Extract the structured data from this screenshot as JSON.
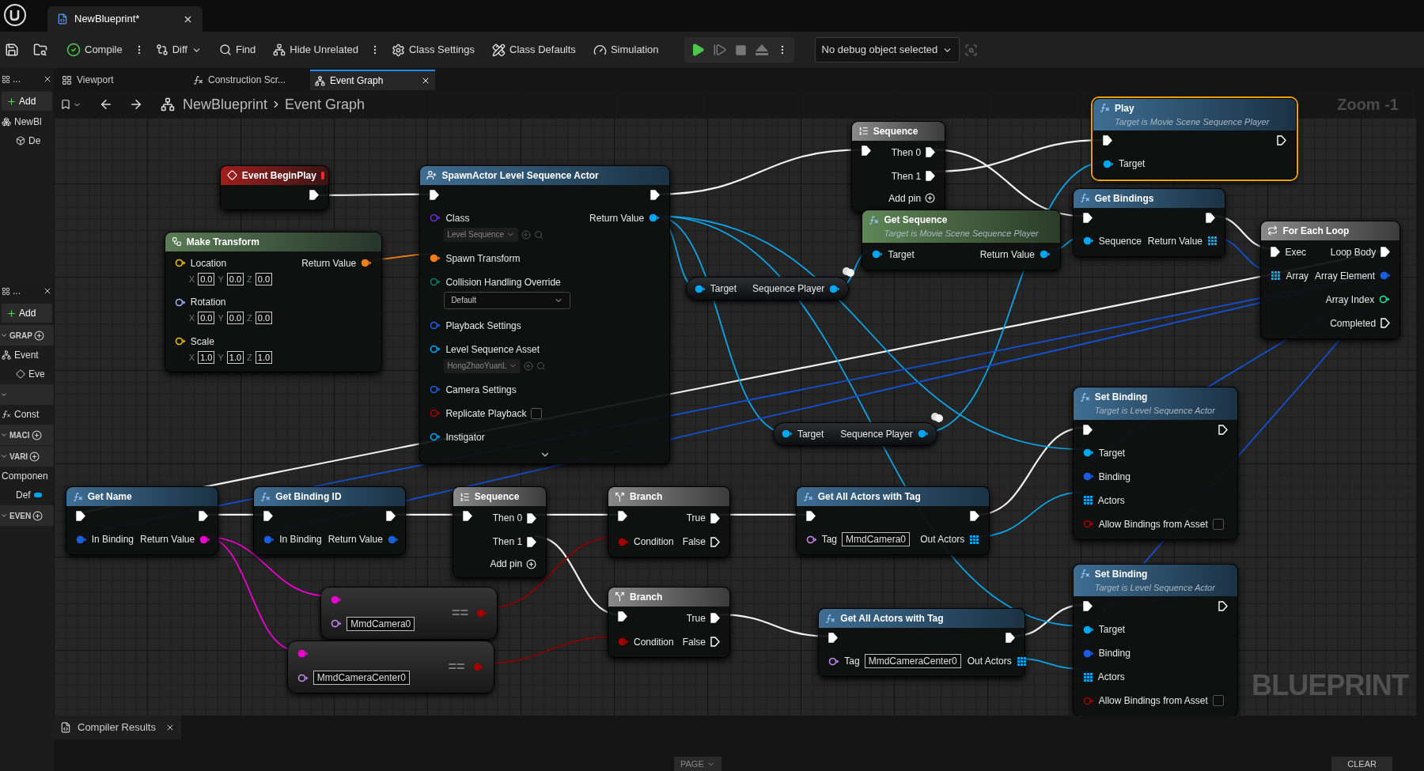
{
  "title_bar": {
    "tabs": [
      {
        "label": "NewBlueprint*",
        "selected": true
      }
    ]
  },
  "toolbar": {
    "buttons": [
      {
        "kind": "compile",
        "label": "Compile"
      },
      {
        "kind": "diff",
        "label": "Diff"
      },
      {
        "kind": "find",
        "label": "Find"
      },
      {
        "kind": "hide-unrelated",
        "label": "Hide Unrelated"
      },
      {
        "kind": "class-settings",
        "label": "Class Settings"
      },
      {
        "kind": "class-defaults",
        "label": "Class Defaults"
      },
      {
        "kind": "simulation",
        "label": "Simulation"
      }
    ],
    "debug_object": "No debug object selected"
  },
  "components_panel": {
    "tab": "...",
    "add": "Add",
    "tree": [
      {
        "label": "NewBl",
        "children": [
          {
            "label": "De"
          }
        ]
      }
    ]
  },
  "my_blueprint_panel": {
    "tab": "...",
    "add": "Add",
    "sections": [
      {
        "label": "GRAP",
        "items": [
          {
            "kind": "graph",
            "label": "Event",
            "children": [
              {
                "kind": "event",
                "label": "Eve"
              }
            ]
          }
        ]
      },
      {
        "items": [
          {
            "kind": "function",
            "label": "Const"
          }
        ]
      },
      {
        "label": "MACI"
      },
      {
        "label": "VARI",
        "items": [
          {
            "kind": "category",
            "label": "Componen",
            "children": [
              {
                "kind": "variable",
                "label": "Def"
              }
            ]
          }
        ]
      },
      {
        "label": "EVEN"
      }
    ]
  },
  "editor_tabs": [
    {
      "kind": "viewport",
      "label": "Viewport",
      "selected": false
    },
    {
      "kind": "function",
      "label": "Construction Scr...",
      "selected": false
    },
    {
      "kind": "graph",
      "label": "Event Graph",
      "selected": true
    }
  ],
  "graph": {
    "breadcrumb": [
      "NewBlueprint",
      "Event Graph"
    ],
    "zoom": "Zoom -1",
    "watermark": "BLUEPRINT",
    "nodes": [
      {
        "kind": "sequence",
        "title": "Sequence",
        "selected": false,
        "rows": [
          {
            "in": {
              "kind": "exec",
              "linked": true
            },
            "out": {
              "kind": "exec",
              "label": "Then 0",
              "linked": true
            }
          },
          {
            "out": {
              "kind": "exec",
              "label": "Then 1",
              "linked": true
            }
          }
        ],
        "add_pin": "Add pin"
      },
      {
        "kind": "function",
        "title": "Play",
        "subtitle": "Target is Movie Scene Sequence Player",
        "selected": true,
        "rows": [
          {
            "in": {
              "kind": "exec",
              "linked": true
            },
            "out": {
              "kind": "exec",
              "linked": false
            }
          },
          {
            "in": {
              "kind": "object",
              "label": "Target",
              "linked": true
            }
          }
        ]
      },
      {
        "kind": "event",
        "title": "Event BeginPlay",
        "selected": false,
        "rows": [
          {
            "out": {
              "kind": "exec",
              "linked": true
            }
          }
        ]
      },
      {
        "kind": "spawn",
        "title": "SpawnActor Level Sequence Actor",
        "selected": false,
        "advanced_expanded": false,
        "rows": [
          {
            "in": {
              "kind": "exec",
              "linked": true
            },
            "out": {
              "kind": "exec",
              "linked": true
            }
          },
          {
            "in": {
              "kind": "class",
              "label": "Class",
              "linked": false,
              "dropdown": "Level Sequence"
            },
            "out": {
              "kind": "object",
              "label": "Return Value",
              "linked": true
            }
          },
          {
            "in": {
              "kind": "transform",
              "label": "Spawn Transform",
              "linked": true
            }
          },
          {
            "in": {
              "kind": "enum",
              "label": "Collision Handling Override",
              "linked": false,
              "select": "Default"
            }
          },
          {
            "in": {
              "kind": "struct",
              "label": "Playback Settings",
              "linked": false
            }
          },
          {
            "in": {
              "kind": "object",
              "label": "Level Sequence Asset",
              "linked": false,
              "dropdown": "HongZhaoYuanL"
            }
          },
          {
            "in": {
              "kind": "struct",
              "label": "Camera Settings",
              "linked": false
            }
          },
          {
            "in": {
              "kind": "bool",
              "label": "Replicate Playback",
              "linked": false,
              "checked": false
            }
          },
          {
            "in": {
              "kind": "object",
              "label": "Instigator",
              "linked": false
            }
          }
        ]
      },
      {
        "kind": "function",
        "title": "Get Bindings",
        "selected": false,
        "rows": [
          {
            "in": {
              "kind": "exec",
              "linked": true
            },
            "out": {
              "kind": "exec",
              "linked": true
            }
          },
          {
            "in": {
              "kind": "object",
              "label": "Sequence",
              "linked": true
            },
            "out": {
              "kind": "array",
              "label": "Return Value",
              "linked": true
            }
          }
        ]
      },
      {
        "kind": "pure",
        "title": "Get Sequence",
        "subtitle": "Target is Movie Scene Sequence Player",
        "selected": false,
        "rows": [
          {
            "in": {
              "kind": "object",
              "label": "Target",
              "linked": true
            },
            "out": {
              "kind": "object",
              "label": "Return Value",
              "linked": true
            }
          }
        ]
      },
      {
        "kind": "loop",
        "title": "For Each Loop",
        "selected": false,
        "rows": [
          {
            "in": {
              "kind": "exec",
              "label": "Exec",
              "linked": true
            },
            "out": {
              "kind": "exec",
              "label": "Loop Body",
              "linked": true
            }
          },
          {
            "in": {
              "kind": "array",
              "label": "Array",
              "linked": true
            },
            "out": {
              "kind": "binding",
              "label": "Array Element",
              "linked": true
            }
          },
          {
            "out": {
              "kind": "int",
              "label": "Array Index",
              "linked": false
            }
          },
          {
            "out": {
              "kind": "exec",
              "label": "Completed",
              "linked": false
            }
          }
        ]
      },
      {
        "kind": "make-struct",
        "title": "Make Transform",
        "selected": false,
        "rows": [
          {
            "in": {
              "kind": "vector",
              "label": "Location",
              "linked": false,
              "fields": [
                {
                  "axis": "X",
                  "value": "0.0"
                },
                {
                  "axis": "Y",
                  "value": "0.0"
                },
                {
                  "axis": "Z",
                  "value": "0.0"
                }
              ]
            },
            "out": {
              "kind": "transform",
              "label": "Return Value",
              "linked": true
            }
          },
          {
            "in": {
              "kind": "rotator",
              "label": "Rotation",
              "linked": false,
              "fields": [
                {
                  "axis": "X",
                  "value": "0.0"
                },
                {
                  "axis": "Y",
                  "value": "0.0"
                },
                {
                  "axis": "Z",
                  "value": "0.0"
                }
              ]
            }
          },
          {
            "in": {
              "kind": "vector",
              "label": "Scale",
              "linked": false,
              "fields": [
                {
                  "axis": "X",
                  "value": "1.0"
                },
                {
                  "axis": "Y",
                  "value": "1.0"
                },
                {
                  "axis": "Z",
                  "value": "1.0"
                }
              ]
            }
          }
        ]
      },
      {
        "kind": "getter",
        "selected": false,
        "rows": [
          {
            "in": {
              "kind": "object",
              "label": "Target",
              "linked": true
            },
            "out": {
              "kind": "object",
              "label": "Sequence Player",
              "linked": true
            }
          }
        ]
      },
      {
        "kind": "function",
        "title": "Set Binding",
        "subtitle": "Target is Level Sequence Actor",
        "selected": false,
        "rows": [
          {
            "in": {
              "kind": "exec",
              "linked": true
            },
            "out": {
              "kind": "exec",
              "linked": false
            }
          },
          {
            "in": {
              "kind": "object",
              "label": "Target",
              "linked": true
            }
          },
          {
            "in": {
              "kind": "binding",
              "label": "Binding",
              "linked": true
            }
          },
          {
            "in": {
              "kind": "array",
              "label": "Actors",
              "linked": true
            }
          },
          {
            "in": {
              "kind": "bool",
              "label": "Allow Bindings from Asset",
              "linked": false,
              "checked": false
            }
          }
        ]
      },
      {
        "kind": "getter",
        "selected": false,
        "rows": [
          {
            "in": {
              "kind": "object",
              "label": "Target",
              "linked": true
            },
            "out": {
              "kind": "object",
              "label": "Sequence Player",
              "linked": true
            }
          }
        ]
      },
      {
        "kind": "function",
        "title": "Get Name",
        "selected": false,
        "rows": [
          {
            "in": {
              "kind": "exec",
              "linked": true
            },
            "out": {
              "kind": "exec",
              "linked": true
            }
          },
          {
            "in": {
              "kind": "binding",
              "label": "In Binding",
              "linked": true
            },
            "out": {
              "kind": "string",
              "label": "Return Value",
              "linked": true
            }
          }
        ]
      },
      {
        "kind": "function",
        "title": "Get Binding ID",
        "selected": false,
        "rows": [
          {
            "in": {
              "kind": "exec",
              "linked": true
            },
            "out": {
              "kind": "exec",
              "linked": true
            }
          },
          {
            "in": {
              "kind": "binding",
              "label": "In Binding",
              "linked": true
            },
            "out": {
              "kind": "binding",
              "label": "Return Value",
              "linked": true
            }
          }
        ]
      },
      {
        "kind": "sequence",
        "title": "Sequence",
        "selected": false,
        "rows": [
          {
            "in": {
              "kind": "exec",
              "linked": true
            },
            "out": {
              "kind": "exec",
              "label": "Then 0",
              "linked": true
            }
          },
          {
            "out": {
              "kind": "exec",
              "label": "Then 1",
              "linked": true
            }
          }
        ],
        "add_pin": "Add pin"
      },
      {
        "kind": "branch",
        "title": "Branch",
        "selected": false,
        "rows": [
          {
            "in": {
              "kind": "exec",
              "linked": true
            },
            "out": {
              "kind": "exec",
              "label": "True",
              "linked": true
            }
          },
          {
            "in": {
              "kind": "bool",
              "label": "Condition",
              "linked": true
            },
            "out": {
              "kind": "exec",
              "label": "False",
              "linked": false
            }
          }
        ]
      },
      {
        "kind": "function",
        "title": "Get All Actors with Tag",
        "selected": false,
        "rows": [
          {
            "in": {
              "kind": "exec",
              "linked": true
            },
            "out": {
              "kind": "exec",
              "linked": true
            }
          },
          {
            "in": {
              "kind": "name",
              "label": "Tag",
              "linked": false,
              "value": "MmdCamera0"
            },
            "out": {
              "kind": "array",
              "label": "Out Actors",
              "linked": true
            }
          }
        ]
      },
      {
        "kind": "compare",
        "title": "==",
        "selected": false,
        "rows": [
          {
            "in": {
              "kind": "string",
              "linked": true
            }
          },
          {
            "in": {
              "kind": "name",
              "linked": false,
              "value": "MmdCamera0"
            },
            "out": {
              "kind": "bool",
              "linked": true
            }
          }
        ]
      },
      {
        "kind": "compare",
        "title": "==",
        "selected": false,
        "rows": [
          {
            "in": {
              "kind": "string",
              "linked": true
            }
          },
          {
            "in": {
              "kind": "name",
              "linked": false,
              "value": "MmdCameraCenter0"
            },
            "out": {
              "kind": "bool",
              "linked": true
            }
          }
        ]
      },
      {
        "kind": "branch",
        "title": "Branch",
        "selected": false,
        "rows": [
          {
            "in": {
              "kind": "exec",
              "linked": true
            },
            "out": {
              "kind": "exec",
              "label": "True",
              "linked": true
            }
          },
          {
            "in": {
              "kind": "bool",
              "label": "Condition",
              "linked": true
            },
            "out": {
              "kind": "exec",
              "label": "False",
              "linked": false
            }
          }
        ]
      },
      {
        "kind": "function",
        "title": "Get All Actors with Tag",
        "selected": false,
        "rows": [
          {
            "in": {
              "kind": "exec",
              "linked": true
            },
            "out": {
              "kind": "exec",
              "linked": true
            }
          },
          {
            "in": {
              "kind": "name",
              "label": "Tag",
              "linked": false,
              "value": "MmdCameraCenter0"
            },
            "out": {
              "kind": "array",
              "label": "Out Actors",
              "linked": true
            }
          }
        ]
      },
      {
        "kind": "function",
        "title": "Set Binding",
        "subtitle": "Target is Level Sequence Actor",
        "selected": false,
        "rows": [
          {
            "in": {
              "kind": "exec",
              "linked": true
            },
            "out": {
              "kind": "exec",
              "linked": false
            }
          },
          {
            "in": {
              "kind": "object",
              "label": "Target",
              "linked": true
            }
          },
          {
            "in": {
              "kind": "binding",
              "label": "Binding",
              "linked": true
            }
          },
          {
            "in": {
              "kind": "array",
              "label": "Actors",
              "linked": true
            }
          },
          {
            "in": {
              "kind": "bool",
              "label": "Allow Bindings from Asset",
              "linked": false,
              "checked": false
            }
          }
        ]
      }
    ]
  },
  "bottom_panel": {
    "tab": "Compiler Results",
    "page": "PAGE",
    "clear": "CLEAR"
  }
}
